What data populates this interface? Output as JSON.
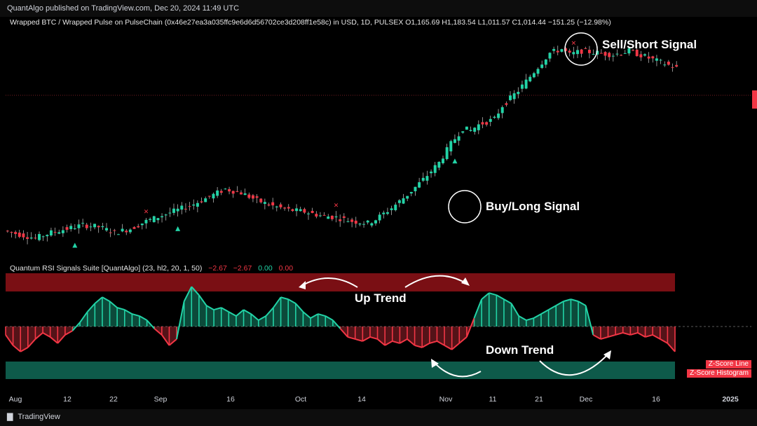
{
  "header": {
    "published": "QuantAlgo published on TradingView.com, Dec 20, 2024 11:49 UTC"
  },
  "symbol_line": "Wrapped BTC / Wrapped Pulse on PulseChain (0x46e27ea3a035ffc9e6d6d56702ce3d208ff1e58c) in USD, 1D, PULSEX  O1,165.69  H1,183.54  L1,011.57  C1,014.44  −151.25 (−12.98%)",
  "indicator": {
    "title": "Quantum RSI Signals Suite [QuantAlgo] (23, hl2, 20, 1, 50)",
    "values": [
      "−2.67",
      "−2.67",
      "0.00",
      "0.00"
    ],
    "legend": [
      "Z-Score Line",
      "Z-Score Histogram"
    ]
  },
  "annotations": {
    "sell": "Sell/Short Signal",
    "buy": "Buy/Long Signal",
    "up": "Up Trend",
    "down": "Down Trend"
  },
  "footer": {
    "brand": "TradingView"
  },
  "colors": {
    "bull": "#22d3a6",
    "bear": "#f23645",
    "background": "#000000"
  },
  "chart_data": {
    "type": "candlestick",
    "x_tick_labels": [
      "Aug",
      "12",
      "22",
      "Sep",
      "16",
      "Oct",
      "14",
      "Nov",
      "11",
      "21",
      "Dec",
      "16",
      "2025"
    ],
    "ohlc": {
      "open": 1165.69,
      "high": 1183.54,
      "low": 1011.57,
      "close": 1014.44,
      "change": -151.25,
      "change_pct": -12.98
    },
    "price_path": [
      [
        0,
        0.04
      ],
      [
        4,
        0.02
      ],
      [
        8,
        0.0
      ],
      [
        12,
        0.03
      ],
      [
        16,
        0.05
      ],
      [
        20,
        0.07
      ],
      [
        24,
        0.06
      ],
      [
        28,
        0.03
      ],
      [
        32,
        0.05
      ],
      [
        36,
        0.09
      ],
      [
        40,
        0.12
      ],
      [
        44,
        0.15
      ],
      [
        48,
        0.18
      ],
      [
        52,
        0.22
      ],
      [
        56,
        0.26
      ],
      [
        60,
        0.24
      ],
      [
        64,
        0.2
      ],
      [
        68,
        0.17
      ],
      [
        72,
        0.15
      ],
      [
        76,
        0.14
      ],
      [
        80,
        0.12
      ],
      [
        84,
        0.11
      ],
      [
        88,
        0.09
      ],
      [
        92,
        0.08
      ],
      [
        94,
        0.1
      ],
      [
        98,
        0.16
      ],
      [
        102,
        0.23
      ],
      [
        106,
        0.31
      ],
      [
        110,
        0.4
      ],
      [
        113,
        0.5
      ],
      [
        116,
        0.58
      ],
      [
        118,
        0.57
      ],
      [
        120,
        0.6
      ],
      [
        124,
        0.63
      ],
      [
        126,
        0.7
      ],
      [
        130,
        0.78
      ],
      [
        134,
        0.88
      ],
      [
        138,
        0.98
      ],
      [
        141,
        1.0
      ],
      [
        143,
        0.97
      ],
      [
        146,
        0.99
      ],
      [
        150,
        0.98
      ],
      [
        154,
        0.97
      ],
      [
        158,
        0.99
      ],
      [
        162,
        0.96
      ],
      [
        166,
        0.93
      ],
      [
        170,
        0.9
      ]
    ],
    "signals": [
      {
        "type": "buy",
        "index": 17
      },
      {
        "type": "sell",
        "index": 35
      },
      {
        "type": "buy",
        "index": 43
      },
      {
        "type": "sell",
        "index": 83
      },
      {
        "type": "buy",
        "index": 113
      },
      {
        "type": "sell",
        "index": 143
      }
    ],
    "zscore": [
      -0.4,
      -0.9,
      -1.2,
      -1.0,
      -0.6,
      -0.3,
      -0.5,
      -0.8,
      -0.4,
      -0.2,
      0.2,
      0.7,
      1.1,
      1.4,
      1.2,
      0.9,
      0.8,
      0.6,
      0.5,
      0.3,
      -0.1,
      -0.4,
      -0.9,
      -0.6,
      1.2,
      1.9,
      1.5,
      1.0,
      0.8,
      0.9,
      0.7,
      0.5,
      0.8,
      0.6,
      0.3,
      0.5,
      0.9,
      1.4,
      1.3,
      1.1,
      0.7,
      0.4,
      0.6,
      0.5,
      0.3,
      -0.1,
      -0.5,
      -0.6,
      -0.7,
      -0.5,
      -0.6,
      -0.9,
      -0.7,
      -0.8,
      -0.6,
      -0.9,
      -1.0,
      -0.8,
      -0.7,
      -0.9,
      -1.1,
      -0.8,
      -0.5,
      0.4,
      1.3,
      1.6,
      1.5,
      1.3,
      1.1,
      0.5,
      0.3,
      0.4,
      0.6,
      0.8,
      1.0,
      1.2,
      1.3,
      1.2,
      1.0,
      -0.4,
      -0.6,
      -0.5,
      -0.4,
      -0.3,
      -0.4,
      -0.3,
      -0.5,
      -0.4,
      -0.6,
      -0.8,
      -1.2
    ],
    "zscore_range": [
      -2.67,
      2.67
    ]
  }
}
